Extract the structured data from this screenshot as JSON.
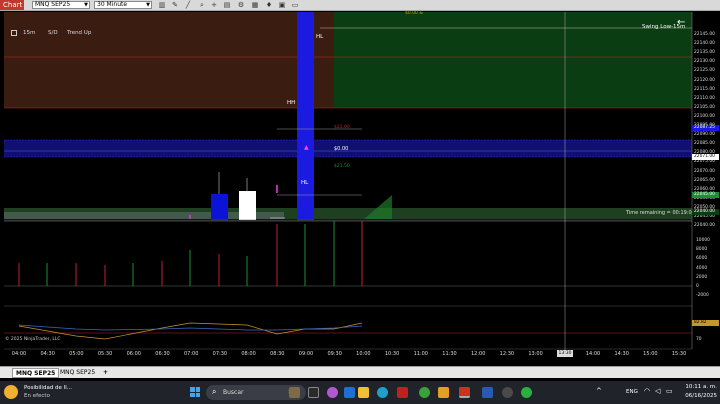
{
  "toolbar": {
    "chart_tab": "Chart",
    "instrument": "MNQ SEP25",
    "timeframe": "30 Minute",
    "icons": [
      "bars-icon",
      "pencil-icon",
      "crosshair-icon",
      "zoom-icon",
      "plus-icon",
      "properties-icon",
      "strategy-icon",
      "chart-style-icon",
      "alerts-icon",
      "dom-icon",
      "order-icon"
    ]
  },
  "chart": {
    "indicator_box": {
      "period": "15m",
      "sd_label": "S/D",
      "trend": "Trend Up"
    },
    "labels": {
      "hl_top": "HL",
      "hh": "HH",
      "hl_mid": "HL",
      "swing_low": "Swing Low-15m",
      "zero": "$0.00",
      "time_remaining": "Time remaining = 00:19:00",
      "copyright": "© 2025 NinjaTrader, LLC",
      "price_red": "$21.00",
      "price_green": "$21.50",
      "top_price": "$0.00 &"
    },
    "price_axis": [
      "22145.00",
      "22140.00",
      "22135.00",
      "22130.00",
      "22125.00",
      "22120.00",
      "22115.00",
      "22110.00",
      "22105.00",
      "22100.00",
      "22095.00",
      "22090.00",
      "22085.00",
      "22080.00",
      "22075.00",
      "22070.00",
      "22065.00",
      "22060.00",
      "22055.00",
      "22050.00",
      "22045.00",
      "22040.00"
    ],
    "price_markers": {
      "blue": "22087.25",
      "white": "22071.00",
      "green": "22045.00",
      "darkgreen": "22040.00",
      "orange": "82.82"
    },
    "volume_axis": [
      "10000",
      "8000",
      "6000",
      "4000",
      "2000",
      "0",
      "-2000"
    ],
    "osc_axis": [
      "70"
    ],
    "time_axis": [
      "04:00",
      "04:30",
      "05:00",
      "05:30",
      "06:00",
      "06:30",
      "07:00",
      "07:30",
      "08:00",
      "08:30",
      "09:00",
      "09:30",
      "10:00",
      "10:30",
      "11:00",
      "11:30",
      "12:00",
      "12:30",
      "13:00",
      "13:30",
      "14:00",
      "14:30",
      "15:00",
      "15:30"
    ],
    "cursor_time": "13:30"
  },
  "bottom_tabs": [
    "MNQ SEP25",
    "MNQ SEP25"
  ],
  "add_tab": "+",
  "taskbar": {
    "notification_title": "Posibilidad de ll...",
    "notification_sub": "En efecto",
    "search": "Buscar",
    "lang": "ENG",
    "time": "10:11 a. m.",
    "date": "06/16/2025"
  },
  "colors": {
    "accent": "#c0392b",
    "supply_zone": "#3a1d10",
    "demand_zone": "#0b3d12",
    "blue_band": "#1b1bd0"
  }
}
